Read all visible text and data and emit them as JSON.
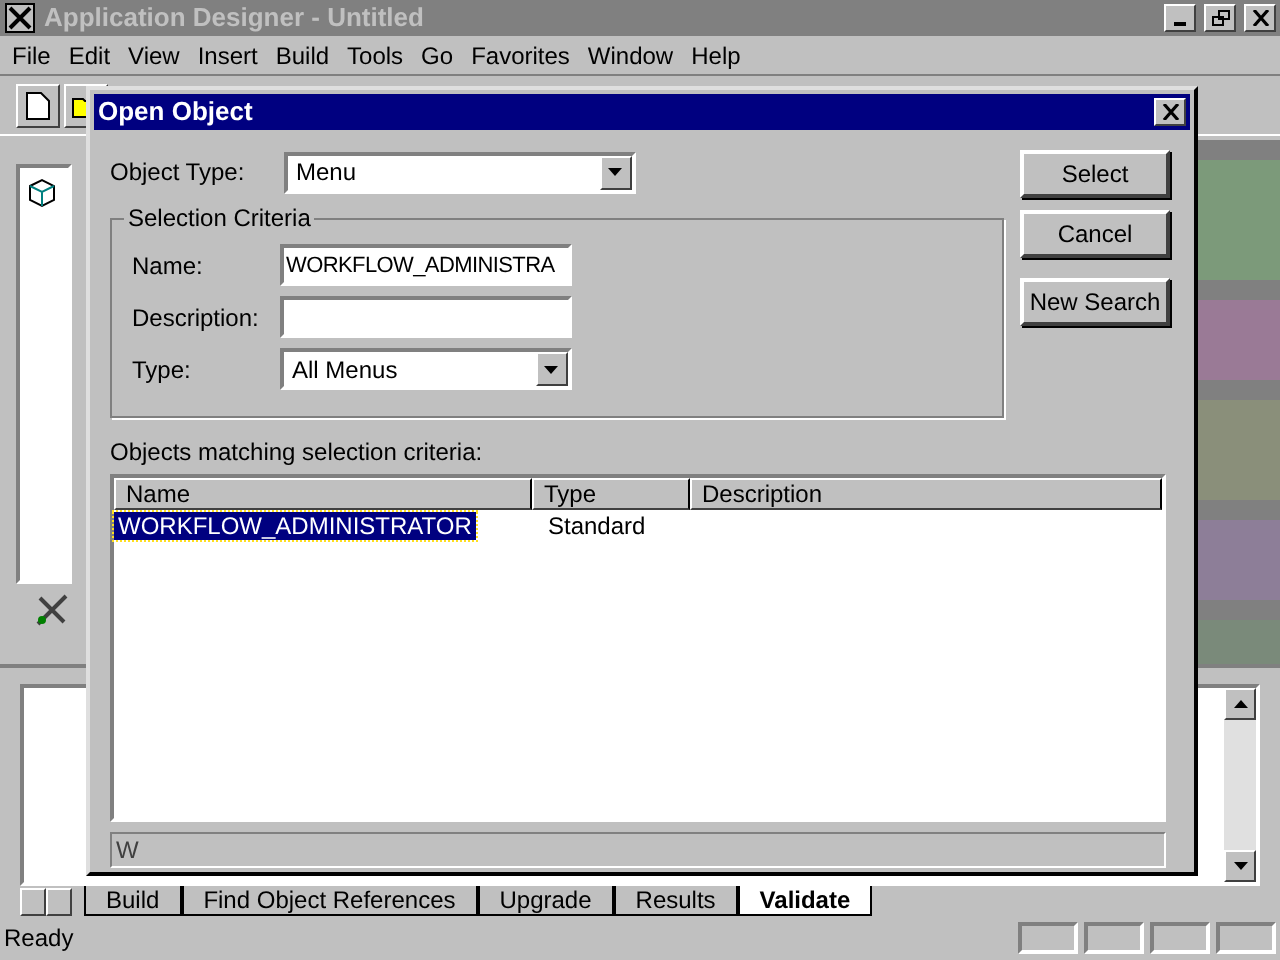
{
  "window": {
    "title": "Application Designer - Untitled",
    "active": false
  },
  "menu": [
    "File",
    "Edit",
    "View",
    "Insert",
    "Build",
    "Tools",
    "Go",
    "Favorites",
    "Window",
    "Help"
  ],
  "output_tabs": [
    {
      "label": "Build",
      "selected": false
    },
    {
      "label": "Find Object References",
      "selected": false
    },
    {
      "label": "Upgrade",
      "selected": false
    },
    {
      "label": "Results",
      "selected": false
    },
    {
      "label": "Validate",
      "selected": true
    }
  ],
  "status_bar": {
    "text": "Ready"
  },
  "dialog": {
    "title": "Open Object",
    "object_type": {
      "label": "Object Type:",
      "value": "Menu"
    },
    "group_title": "Selection Criteria",
    "fields": [
      {
        "kind": "text",
        "label": "Name:",
        "value": "WORKFLOW_ADMINISTRA"
      },
      {
        "kind": "text",
        "label": "Description:"
      },
      {
        "kind": "combo",
        "label": "Type:",
        "value": "All Menus"
      }
    ],
    "buttons": [
      "Select",
      "Cancel",
      "New Search"
    ],
    "results_label": "Objects matching selection criteria:",
    "columns": [
      "Name",
      "Type",
      "Description"
    ],
    "rows": [
      {
        "cells": [
          "WORKFLOW_ADMINISTRATOR",
          "Standard",
          ""
        ],
        "selected": true
      }
    ],
    "status": "W"
  }
}
